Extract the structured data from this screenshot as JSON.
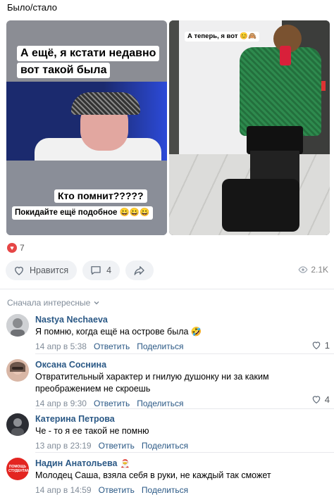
{
  "post": {
    "text": "Было/стало",
    "photo_left": {
      "caption_top_line1": "А ещё, я кстати недавно",
      "caption_top_line2": "вот такой была",
      "caption_question": "Кто помнит?????",
      "caption_bottom": "Покидайте ещё подобное 😀😀😀"
    },
    "photo_right": {
      "caption": "А теперь, я вот 😊🙈"
    }
  },
  "stats": {
    "likes_count": "7",
    "like_label": "Нравится",
    "comments_count": "4",
    "views": "2.1K"
  },
  "sort": {
    "label": "Сначала интересные"
  },
  "comments": [
    {
      "name": "Nastya Nechaeva",
      "text": "Я помню, когда ещё на острове была 🤣",
      "date": "14 апр в 5:38",
      "reply": "Ответить",
      "share": "Поделиться",
      "likes": "1"
    },
    {
      "name": "Оксана Соснина",
      "text": "Отвратительный характер и гнилую душонку ни за каким преображением не скроешь",
      "date": "14 апр в 9:30",
      "reply": "Ответить",
      "share": "Поделиться",
      "likes": "4"
    },
    {
      "name": "Катерина Петрова",
      "text": "Че - то я ее такой не помню",
      "date": "13 апр в 23:19",
      "reply": "Ответить",
      "share": "Поделиться",
      "likes": ""
    },
    {
      "name": "Надин Анатольева",
      "badge": "🎅",
      "text": "Молодец Саша, взяла себя в руки, не каждый так сможет",
      "date": "14 апр в 14:59",
      "reply": "Ответить",
      "share": "Поделиться",
      "likes": "",
      "avatar_text": "ПОМОЩЬ СТУДЕНТАМ"
    }
  ],
  "colors": {
    "link": "#2a5885",
    "meta": "#818c99",
    "like_red": "#e64646",
    "button_bg": "#f0f2f5"
  }
}
